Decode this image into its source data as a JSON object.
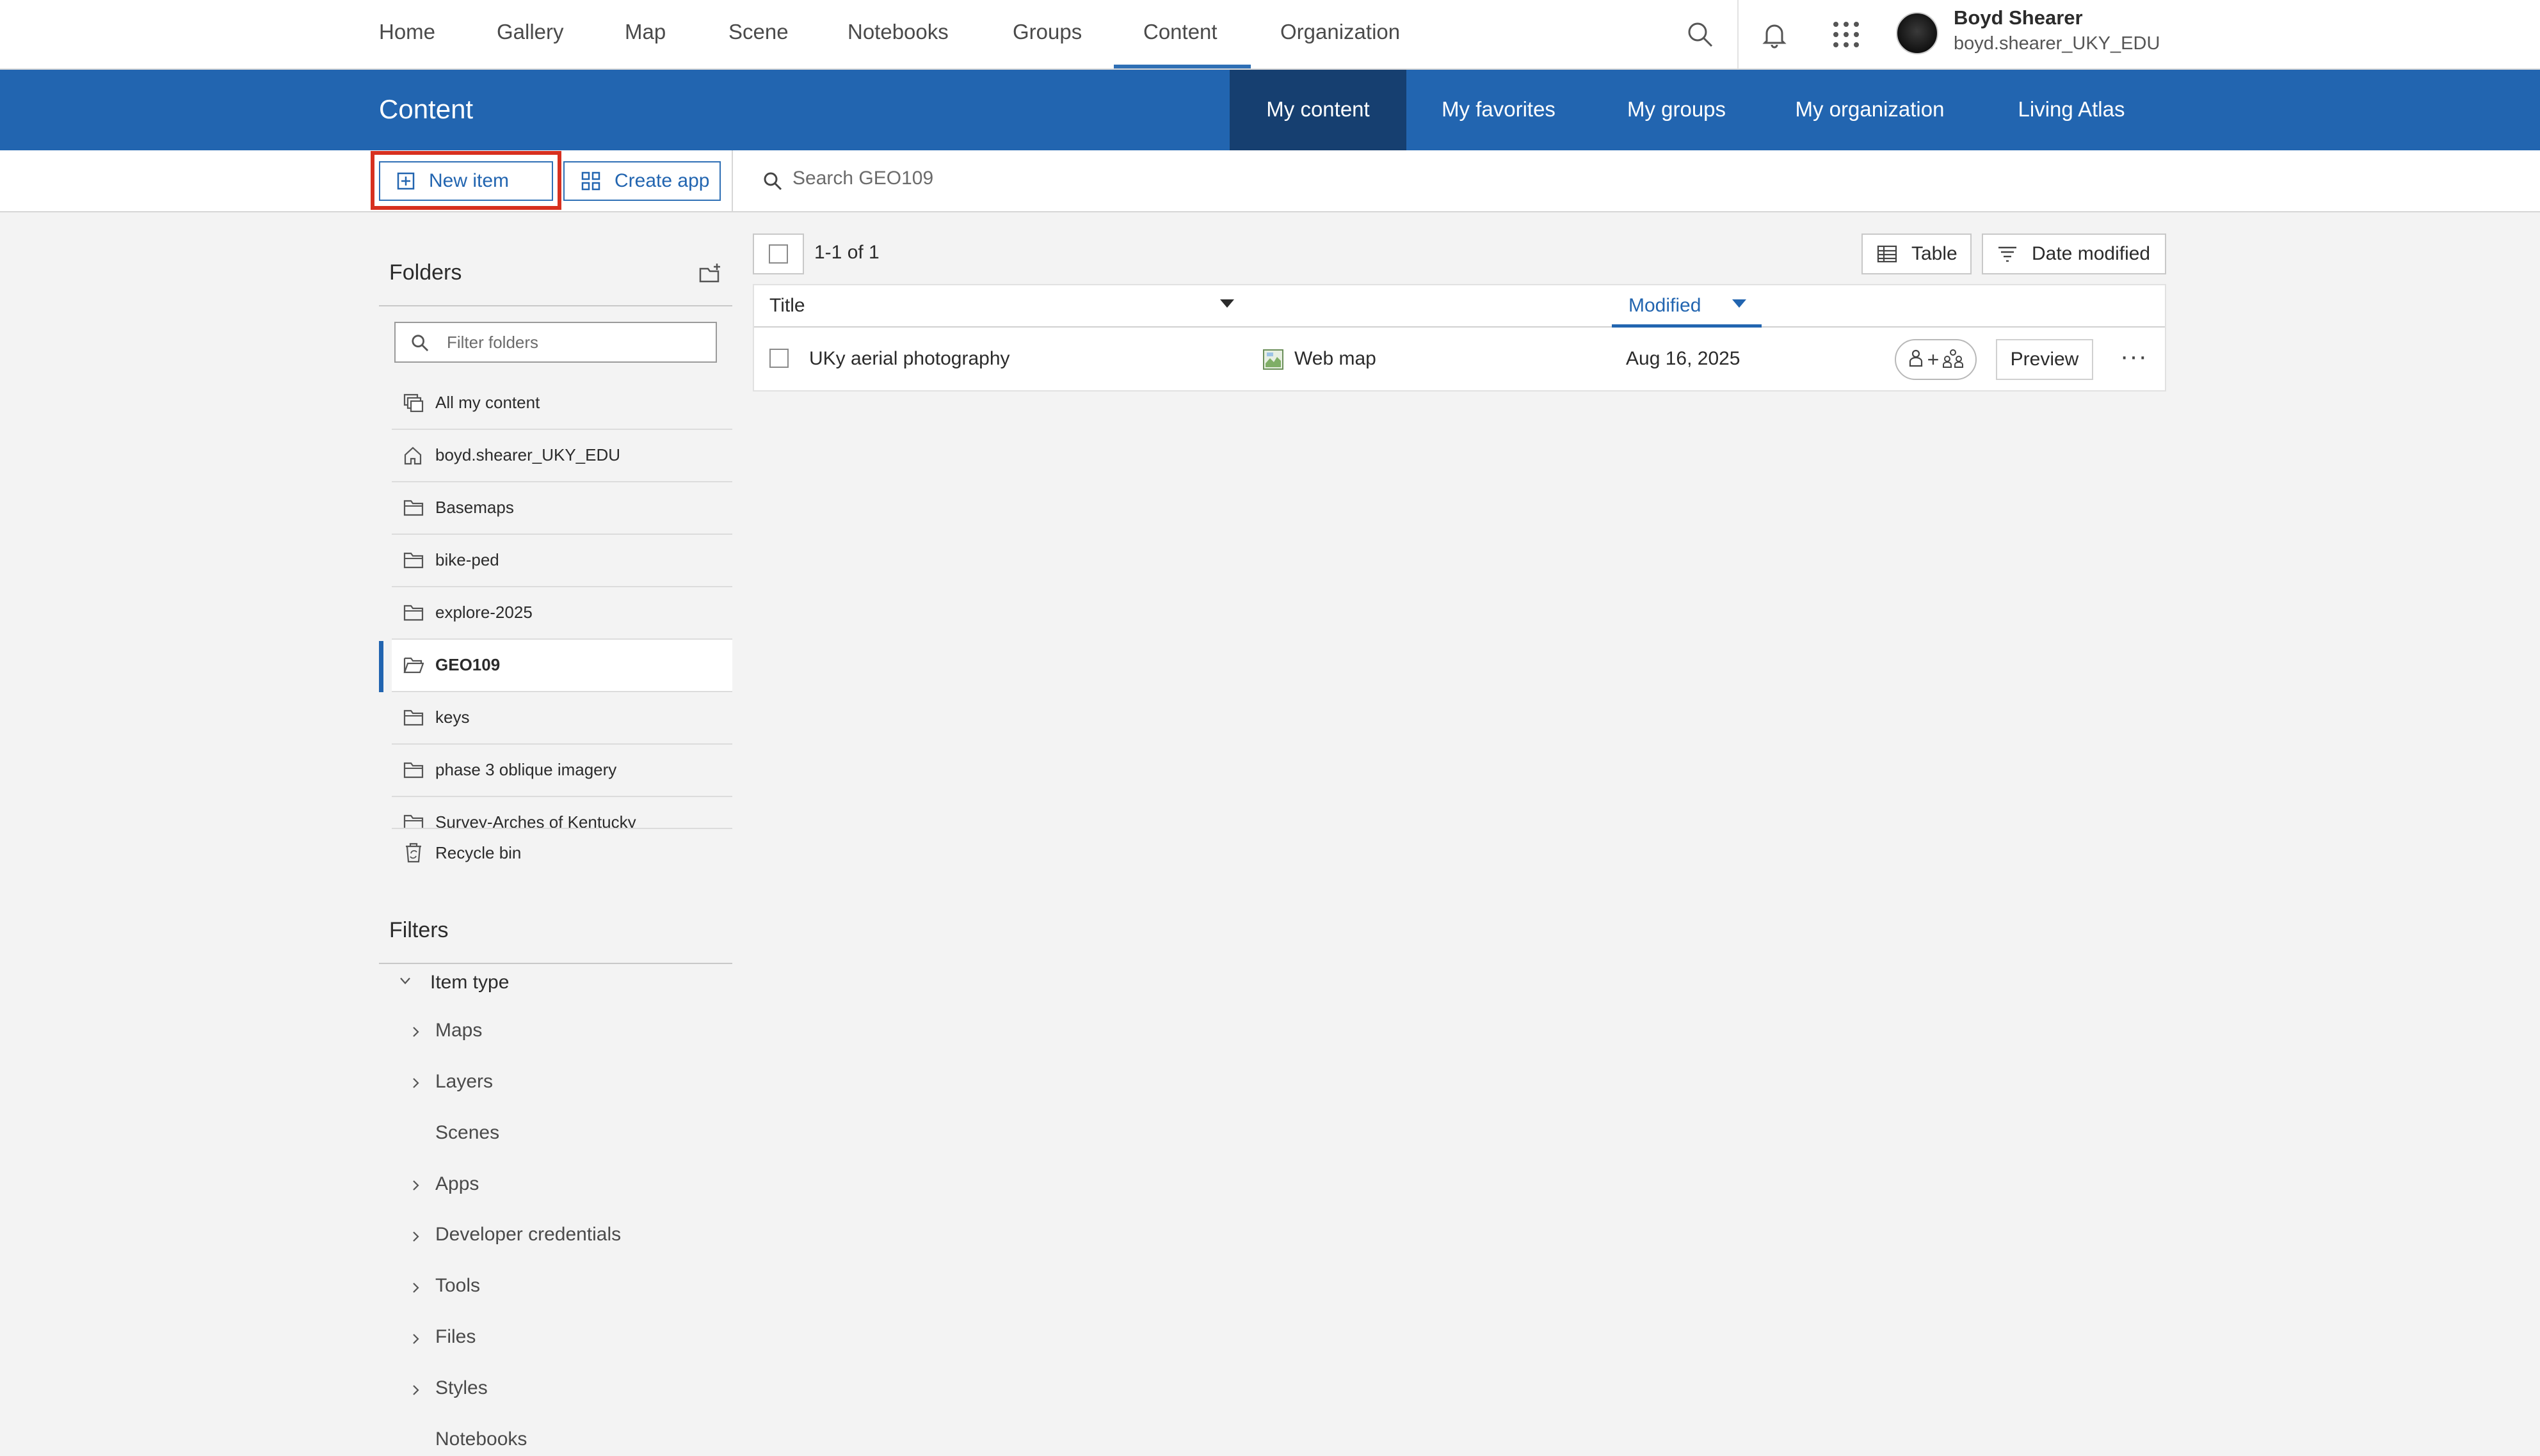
{
  "topnav": {
    "items": [
      "Home",
      "Gallery",
      "Map",
      "Scene",
      "Notebooks",
      "Groups",
      "Content",
      "Organization"
    ],
    "active": "Content",
    "icons": [
      "search-icon",
      "bell-icon",
      "app-launcher-icon"
    ],
    "user": {
      "name": "Boyd Shearer",
      "handle": "boyd.shearer_UKY_EDU"
    }
  },
  "header": {
    "title": "Content",
    "tabs": [
      "My content",
      "My favorites",
      "My groups",
      "My organization",
      "Living Atlas"
    ],
    "active_tab": "My content"
  },
  "toolbar": {
    "new_item": "New item",
    "create_app": "Create app",
    "search_placeholder": "Search GEO109"
  },
  "sidebar": {
    "folders_title": "Folders",
    "filter_placeholder": "Filter folders",
    "folders": [
      {
        "label": "All my content",
        "icon": "stack-icon"
      },
      {
        "label": "boyd.shearer_UKY_EDU",
        "icon": "home-icon"
      },
      {
        "label": "Basemaps",
        "icon": "folder-icon"
      },
      {
        "label": "bike-ped",
        "icon": "folder-icon"
      },
      {
        "label": "explore-2025",
        "icon": "folder-icon"
      },
      {
        "label": "GEO109",
        "icon": "folder-open-icon",
        "active": true
      },
      {
        "label": "keys",
        "icon": "folder-icon"
      },
      {
        "label": "phase 3 oblique imagery",
        "icon": "folder-icon"
      },
      {
        "label": "Survey-Arches of Kentucky",
        "icon": "folder-icon"
      }
    ],
    "recycle_bin": "Recycle bin",
    "filters_title": "Filters",
    "item_type_label": "Item type",
    "item_types": [
      {
        "label": "Maps",
        "expandable": true
      },
      {
        "label": "Layers",
        "expandable": true
      },
      {
        "label": "Scenes",
        "expandable": false
      },
      {
        "label": "Apps",
        "expandable": true
      },
      {
        "label": "Developer credentials",
        "expandable": true
      },
      {
        "label": "Tools",
        "expandable": true
      },
      {
        "label": "Files",
        "expandable": true
      },
      {
        "label": "Styles",
        "expandable": true
      },
      {
        "label": "Notebooks",
        "expandable": false
      }
    ]
  },
  "main": {
    "count": "1-1 of 1",
    "view_button": "Table",
    "sort_button": "Date modified",
    "columns": {
      "title": "Title",
      "modified": "Modified"
    },
    "rows": [
      {
        "title": "UKy aerial photography",
        "type": "Web map",
        "modified": "Aug 16, 2025",
        "preview": "Preview",
        "more": "···"
      }
    ]
  },
  "colors": {
    "brand": "#2265b0",
    "active_tab": "#163f70",
    "highlight": "#d7301f"
  }
}
